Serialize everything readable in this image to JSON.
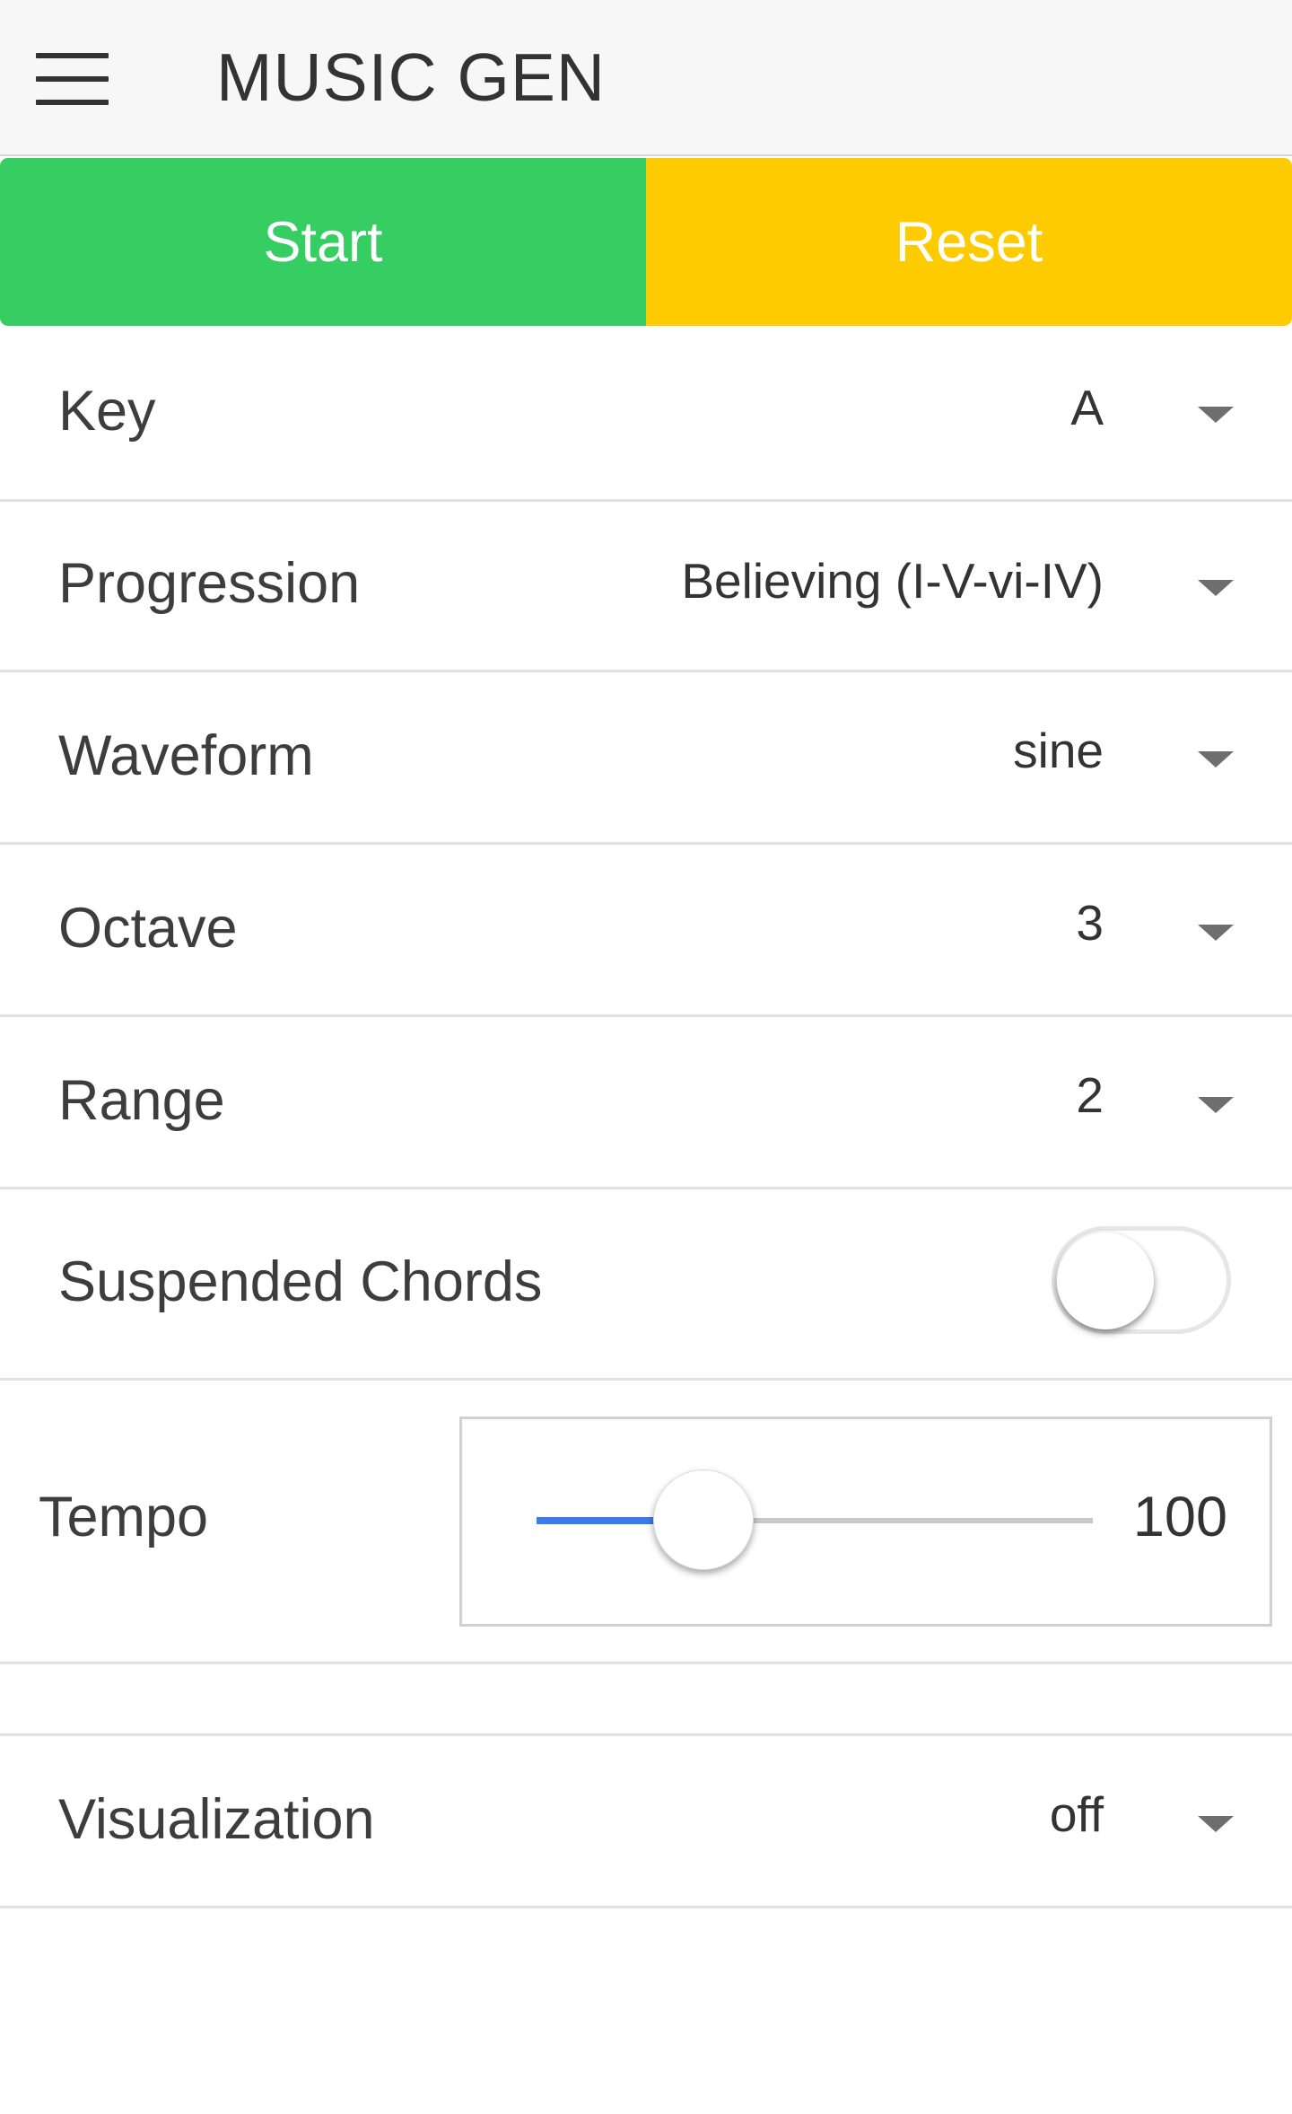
{
  "header": {
    "title": "MUSIC GEN",
    "menu_icon": "hamburger-menu-icon"
  },
  "buttons": {
    "start": "Start",
    "reset": "Reset",
    "start_color": "#36cd62",
    "reset_color": "#fecb00"
  },
  "settings": {
    "key": {
      "label": "Key",
      "value": "A"
    },
    "progression": {
      "label": "Progression",
      "value": "Believing (I-V-vi-IV)"
    },
    "waveform": {
      "label": "Waveform",
      "value": "sine"
    },
    "octave": {
      "label": "Octave",
      "value": "3"
    },
    "range": {
      "label": "Range",
      "value": "2"
    },
    "suspended_chords": {
      "label": "Suspended Chords",
      "enabled": false
    },
    "tempo": {
      "label": "Tempo",
      "value": "100",
      "slider_fraction": 0.3
    },
    "visualization": {
      "label": "Visualization",
      "value": "off"
    }
  },
  "colors": {
    "slider_fill": "#3d7be6",
    "dropdown_caret": "#6e6e6e"
  }
}
